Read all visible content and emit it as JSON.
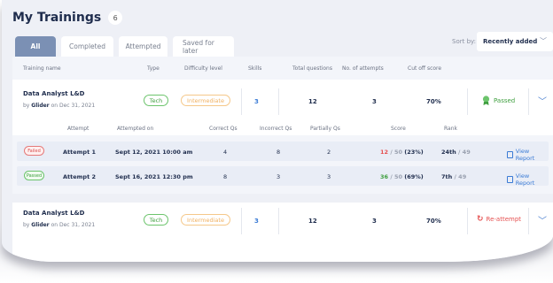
{
  "page": {
    "title": "My Trainings",
    "count": "6"
  },
  "tabs": [
    {
      "label": "All"
    },
    {
      "label": "Completed"
    },
    {
      "label": "Attempted"
    },
    {
      "label": "Saved for later"
    }
  ],
  "sort": {
    "label": "Sort by:",
    "value": "Recently added"
  },
  "columns": {
    "name": "Training name",
    "type": "Type",
    "difficulty": "Difficulty level",
    "skills": "Skills",
    "questions": "Total questions",
    "attempts": "No. of attempts",
    "cutoff": "Cut off score"
  },
  "courses": [
    {
      "name": "Data Analyst L&D",
      "by_prefix": "by",
      "by_name": "Glider",
      "by_suffix": "on Dec 31, 2021",
      "type": "Tech",
      "difficulty": "Intermediate",
      "skills": "3",
      "questions": "12",
      "attempts": "3",
      "cutoff": "70%",
      "status": "Passed"
    },
    {
      "name": "Data Analyst L&D",
      "by_prefix": "by",
      "by_name": "Glider",
      "by_suffix": "on Dec 31, 2021",
      "type": "Tech",
      "difficulty": "Intermediate",
      "skills": "3",
      "questions": "12",
      "attempts": "3",
      "cutoff": "70%",
      "status": "Re-attempt"
    }
  ],
  "attempt_columns": {
    "attempt": "Attempt",
    "on": "Attempted on",
    "correct": "Correct Qs",
    "incorrect": "Incorrect Qs",
    "partial": "Partially Qs",
    "score": "Score",
    "rank": "Rank"
  },
  "attempts": [
    {
      "tag": "Failed",
      "attempt": "Attempt 1",
      "on": "Sept 12, 2021  10:00 am",
      "correct": "4",
      "incorrect": "8",
      "partial": "2",
      "score": "12",
      "score_total": "/ 50",
      "score_pct": "(23%)",
      "rank": "24th",
      "rank_total": "/ 49",
      "report": "View Report"
    },
    {
      "tag": "Passed",
      "attempt": "Attempt 2",
      "on": "Sept 16, 2021  12:30 pm",
      "correct": "8",
      "incorrect": "3",
      "partial": "3",
      "score": "36",
      "score_total": "/ 50",
      "score_pct": "(69%)",
      "rank": "7th",
      "rank_total": "/ 49",
      "report": "View Report"
    }
  ],
  "colors": {
    "accent": "#7b90b4",
    "link": "#3a7bd5",
    "pass": "#3f9f3f",
    "fail": "#e55050",
    "warn": "#f0b060"
  }
}
